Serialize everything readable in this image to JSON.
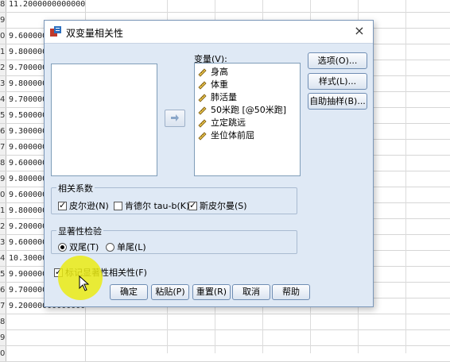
{
  "sheet": {
    "row_numbers": [
      "8",
      "9",
      "0",
      "1",
      "2",
      "3",
      "4",
      "5",
      "6",
      "7",
      "8",
      "9",
      "0",
      "1",
      "2",
      "3",
      "4",
      "5",
      "6",
      "7",
      "8",
      "9",
      "0"
    ],
    "values": [
      "11.2000000000000",
      "",
      "9.60000000000000",
      "9.80000000000000",
      "9.70000000000000",
      "9.80000000000000",
      "9.70000000000000",
      "9.50000000000000",
      "9.30000000000000",
      "9.00000000000000",
      "9.60000000000000",
      "9.80000000000000",
      "9.60000000000000",
      "9.80000000000000",
      "9.20000000000000",
      "9.60000000000000",
      "10.3000000000000",
      "9.90000000000000",
      "9.70000000000000",
      "9.20000000000000",
      "",
      "",
      ""
    ]
  },
  "dialog": {
    "title": "双变量相关性",
    "close_glyph": "×",
    "variables_label": "变量(V):",
    "variables": [
      "身高",
      "体重",
      "肺活量",
      "50米跑 [@50米跑]",
      "立定跳远",
      "坐位体前屈"
    ],
    "buttons_side": [
      "选项(O)...",
      "样式(L)...",
      "自助抽样(B)..."
    ],
    "correlation_group": {
      "legend": "相关系数",
      "pearson": "皮尔逊(N)",
      "kendall": "肯德尔 tau-b(K)",
      "spearman": "斯皮尔曼(S)",
      "pearson_checked": true,
      "kendall_checked": false,
      "spearman_checked": true
    },
    "significance_group": {
      "legend": "显著性检验",
      "two_tailed": "双尾(T)",
      "one_tailed": "单尾(L)",
      "selected": "two_tailed"
    },
    "flag_significant": "标记显著性相关性(F)",
    "flag_checked": true,
    "buttons_bottom": [
      "确定",
      "粘贴(P)",
      "重置(R)",
      "取消",
      "帮助"
    ]
  },
  "colors": {
    "dialog_bg": "#dfe9f5",
    "highlight": "#ebeb14"
  }
}
